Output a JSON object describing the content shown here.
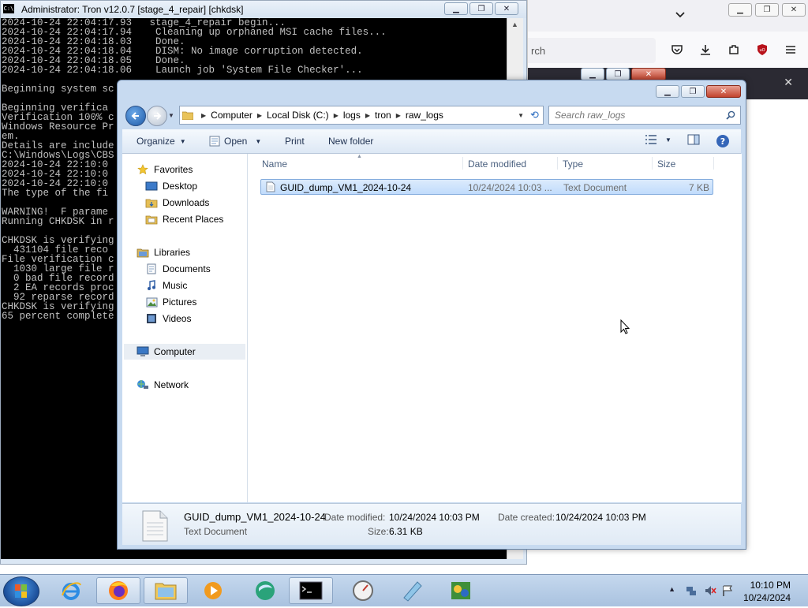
{
  "firefox": {
    "url_fragment": "rch"
  },
  "cmd": {
    "title": "Administrator:  Tron v12.0.7 [stage_4_repair] [chkdsk]",
    "lines": [
      "2024-10-24 22:04:17.93   stage_4_repair begin...",
      "2024-10-24 22:04:17.94    Cleaning up orphaned MSI cache files...",
      "2024-10-24 22:04:18.03    Done.",
      "2024-10-24 22:04:18.04    DISM: No image corruption detected.",
      "2024-10-24 22:04:18.05    Done.",
      "2024-10-24 22:04:18.06    Launch job 'System File Checker'...",
      "",
      "Beginning system sc",
      "",
      "Beginning verifica",
      "Verification 100% c",
      "Windows Resource Pr",
      "em.",
      "Details are include",
      "C:\\Windows\\Logs\\CBS",
      "2024-10-24 22:10:0",
      "2024-10-24 22:10:0",
      "2024-10-24 22:10:0",
      "The type of the fi",
      "",
      "WARNING!  F parame",
      "Running CHKDSK in r",
      "",
      "CHKDSK is verifying",
      "  431104 file reco",
      "File verification c",
      "  1030 large file r",
      "  0 bad file record",
      "  2 EA records proc",
      "  92 reparse record",
      "CHKDSK is verifying",
      "65 percent complete"
    ]
  },
  "explorer": {
    "breadcrumb": [
      "Computer",
      "Local Disk (C:)",
      "logs",
      "tron",
      "raw_logs"
    ],
    "search_placeholder": "Search raw_logs",
    "toolbar": {
      "organize": "Organize",
      "open": "Open",
      "print": "Print",
      "new_folder": "New folder"
    },
    "nav": {
      "favorites": "Favorites",
      "desktop": "Desktop",
      "downloads": "Downloads",
      "recent_places": "Recent Places",
      "libraries": "Libraries",
      "documents": "Documents",
      "music": "Music",
      "pictures": "Pictures",
      "videos": "Videos",
      "computer": "Computer",
      "network": "Network"
    },
    "columns": {
      "name": "Name",
      "date_modified": "Date modified",
      "type": "Type",
      "size": "Size"
    },
    "files": [
      {
        "name": "GUID_dump_VM1_2024-10-24",
        "date_modified": "10/24/2024 10:03 ...",
        "type": "Text Document",
        "size": "7 KB"
      }
    ],
    "details": {
      "name": "GUID_dump_VM1_2024-10-24",
      "type": "Text Document",
      "date_modified_label": "Date modified:",
      "date_modified": "10/24/2024 10:03 PM",
      "date_created_label": "Date created:",
      "date_created": "10/24/2024 10:03 PM",
      "size_label": "Size:",
      "size": "6.31 KB"
    }
  },
  "taskbar": {
    "time": "10:10 PM",
    "date": "10/24/2024"
  },
  "colors": {
    "selection_fill": "#cce2fc",
    "selection_border": "#84acdd",
    "console_bg": "#000000",
    "console_fg": "#c0c0c0"
  }
}
